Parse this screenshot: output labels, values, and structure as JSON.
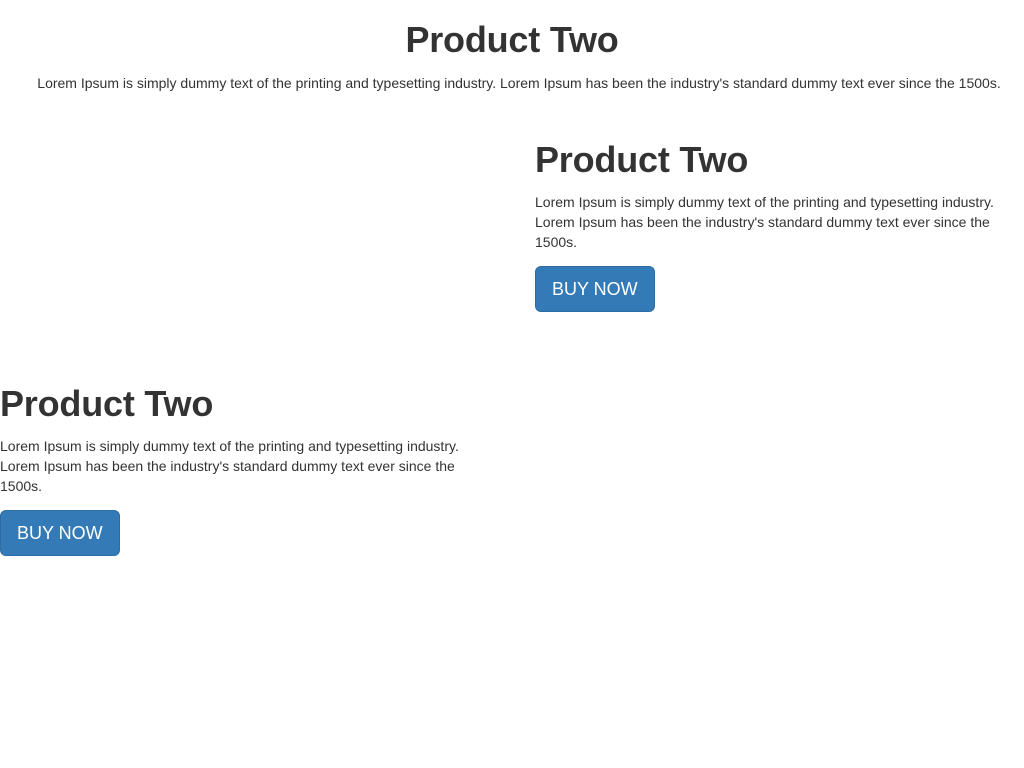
{
  "hero": {
    "title": "Product Two",
    "description": "Lorem Ipsum is simply dummy text of the printing and typesetting industry. Lorem Ipsum has been the industry's standard dummy text ever since the 1500s."
  },
  "products": [
    {
      "title": "Product Two",
      "description": "Lorem Ipsum is simply dummy text of the printing and typesetting industry. Lorem Ipsum has been the industry's standard dummy text ever since the 1500s.",
      "button_label": "BUY NOW"
    },
    {
      "title": "Product Two",
      "description": "Lorem Ipsum is simply dummy text of the printing and typesetting industry. Lorem Ipsum has been the industry's standard dummy text ever since the 1500s.",
      "button_label": "BUY NOW"
    }
  ],
  "colors": {
    "text": "#333333",
    "button_background": "#337ab7",
    "button_border": "#2e6da4",
    "button_text": "#ffffff",
    "page_background": "#ffffff"
  }
}
